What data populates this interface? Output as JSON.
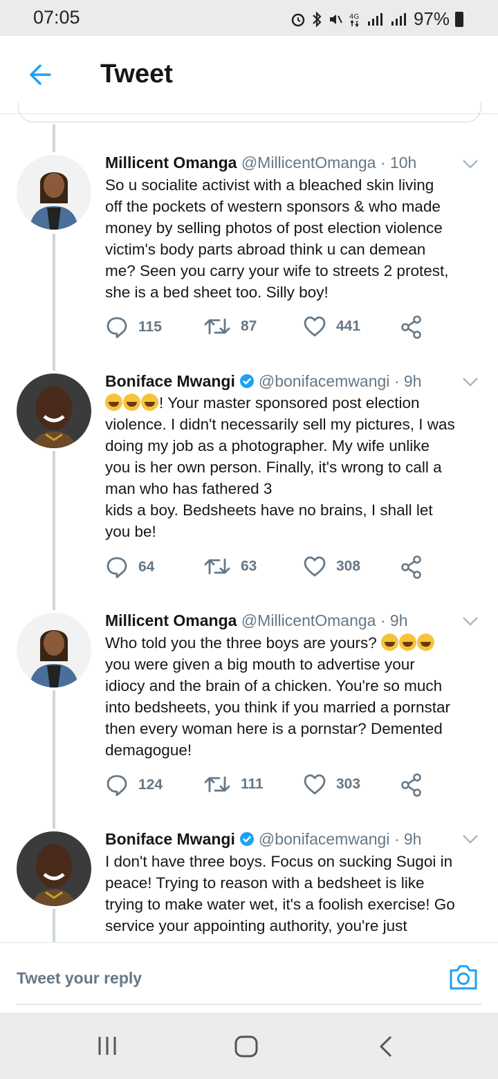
{
  "status_bar": {
    "time": "07:05",
    "battery": "97%"
  },
  "header": {
    "title": "Tweet"
  },
  "tweets": [
    {
      "name": "Millicent Omanga",
      "handle": "@MillicentOmanga",
      "time": "· 10h",
      "verified": false,
      "lines": [
        "So u socialite activist with a bleached skin living",
        "off the pockets of western sponsors & who made",
        "money by selling photos of post election violence",
        "victim's body parts abroad think u can demean",
        "me? Seen you carry your wife to streets 2 protest,",
        "she is a bed sheet too. Silly boy!"
      ],
      "replies": "115",
      "retweets": "87",
      "likes": "441"
    },
    {
      "name": "Boniface Mwangi",
      "handle": "@bonifacemwangi",
      "time": "· 9h",
      "verified": true,
      "lines": [
        "! Your master sponsored post election",
        "violence. I didn't necessarily sell my pictures, I was",
        "doing my job as a photographer. My wife unlike",
        "you is her own person. Finally, it's wrong to call a",
        "man who has fathered 3",
        "kids a boy. Bedsheets have no brains, I shall let",
        "you be!"
      ],
      "replies": "64",
      "retweets": "63",
      "likes": "308"
    },
    {
      "name": "Millicent Omanga",
      "handle": "@MillicentOmanga",
      "time": "· 9h",
      "verified": false,
      "lines": [
        "Who told you the three boys are yours?",
        "you were given a big mouth to advertise your",
        "idiocy and the brain of a chicken. You're so much",
        "into bedsheets, you think if you married a pornstar",
        "then every woman here is a pornstar? Demented",
        "demagogue!"
      ],
      "replies": "124",
      "retweets": "111",
      "likes": "303"
    },
    {
      "name": "Boniface Mwangi",
      "handle": "@bonifacemwangi",
      "time": "· 9h",
      "verified": true,
      "lines": [
        "I don't have three boys. Focus on sucking Sugoi in",
        "peace! Trying to reason with a bedsheet is like",
        "trying to make water wet, it's a foolish exercise! Go",
        "service your appointing authority, you're just"
      ]
    }
  ],
  "reply_bar": {
    "placeholder": "Tweet your reply"
  },
  "colors": {
    "accent": "#1da1f2",
    "text": "#14171a",
    "secondary": "#657786",
    "thread_line": "#ccd6dd"
  }
}
